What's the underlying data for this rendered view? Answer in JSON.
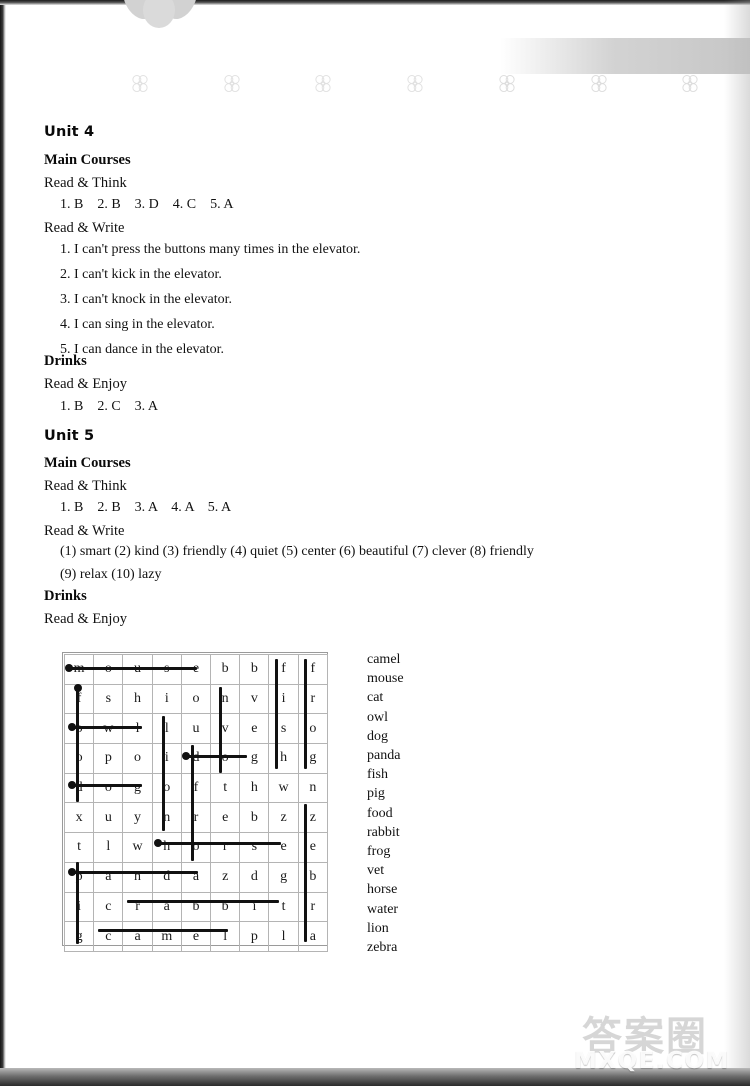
{
  "page": {
    "watermark_cn": "答案圈",
    "watermark_en": "MXQE.COM"
  },
  "unit4": {
    "title": "Unit 4",
    "main_courses": "Main Courses",
    "read_think": "Read & Think",
    "read_think_answers": "1. B    2. B    3. D    4. C    5. A",
    "read_write": "Read & Write",
    "sentences": [
      "1. I can't press the buttons many times in the elevator.",
      "2. I can't kick in the elevator.",
      "3. I can't knock in the elevator.",
      "4. I can sing in the elevator.",
      "5. I can dance in the elevator."
    ],
    "drinks": "Drinks",
    "read_enjoy": "Read & Enjoy",
    "read_enjoy_answers": "1. B    2. C    3. A"
  },
  "unit5": {
    "title": "Unit 5",
    "main_courses": "Main Courses",
    "read_think": "Read & Think",
    "read_think_answers": "1. B    2. B    3. A    4. A    5. A",
    "read_write": "Read & Write",
    "read_write_line1": "(1) smart    (2) kind    (3) friendly    (4) quiet    (5) center    (6) beautiful    (7) clever    (8) friendly",
    "read_write_line2": "(9) relax    (10) lazy",
    "drinks": "Drinks",
    "read_enjoy": "Read & Enjoy"
  },
  "wordsearch": {
    "rows": 10,
    "cols": 9,
    "grid": [
      [
        "m",
        "o",
        "u",
        "s",
        "e",
        "b",
        "b",
        "f",
        "f"
      ],
      [
        "f",
        "s",
        "h",
        "i",
        "o",
        "n",
        "v",
        "i",
        "r"
      ],
      [
        "o",
        "w",
        "l",
        "l",
        "u",
        "v",
        "e",
        "s",
        "o"
      ],
      [
        "o",
        "p",
        "o",
        "i",
        "d",
        "o",
        "g",
        "h",
        "g"
      ],
      [
        "d",
        "o",
        "g",
        "o",
        "f",
        "t",
        "h",
        "w",
        "n"
      ],
      [
        "x",
        "u",
        "y",
        "n",
        "r",
        "e",
        "b",
        "z",
        "z"
      ],
      [
        "t",
        "l",
        "w",
        "h",
        "o",
        "r",
        "s",
        "e",
        "e"
      ],
      [
        "p",
        "a",
        "n",
        "d",
        "a",
        "z",
        "d",
        "g",
        "b"
      ],
      [
        "i",
        "c",
        "r",
        "a",
        "b",
        "b",
        "i",
        "t",
        "r"
      ],
      [
        "g",
        "c",
        "a",
        "m",
        "e",
        "l",
        "p",
        "l",
        "a"
      ]
    ],
    "word_list": [
      "camel",
      "mouse",
      "cat",
      "owl",
      "dog",
      "panda",
      "fish",
      "pig",
      "food",
      "rabbit",
      "frog",
      "vet",
      "horse",
      "water",
      "lion",
      "zebra"
    ],
    "strike_color": "#111111"
  }
}
